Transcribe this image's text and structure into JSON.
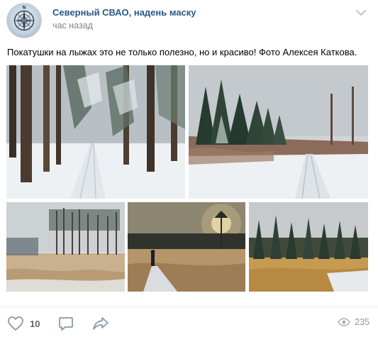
{
  "post": {
    "author": "Северный СВАО, надень маску",
    "time": "час назад",
    "text": "Покатушки на лыжах это не только полезно, но и красиво! Фото Алексея Каткова.",
    "avatar_letter": "N"
  },
  "photos": [
    {
      "name": "photo-forest-ski-track",
      "alt": "snowy forest with ski track"
    },
    {
      "name": "photo-firs-snowfield",
      "alt": "snowy field with fir trees"
    },
    {
      "name": "photo-pines-field",
      "alt": "pine trees over snowy field"
    },
    {
      "name": "photo-skier-sunset",
      "alt": "skier at sunset in meadow"
    },
    {
      "name": "photo-golden-meadow",
      "alt": "golden grass meadow and pines"
    }
  ],
  "footer": {
    "likes": "10",
    "views": "235"
  },
  "colors": {
    "link": "#2a5885",
    "secondary": "#828282",
    "icon": "#8a98a8"
  },
  "icons": [
    "chevron-down-icon",
    "heart-icon",
    "comment-icon",
    "share-icon",
    "eye-icon",
    "compass-icon"
  ]
}
